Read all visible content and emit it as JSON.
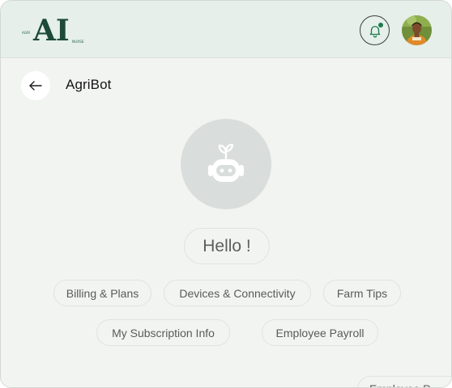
{
  "header": {
    "logo": {
      "small_prefix": "AGRI",
      "big": "AI",
      "small_suffix": "NURSE"
    },
    "bell_icon": "bell-icon",
    "avatar_icon": "user-avatar"
  },
  "page": {
    "back_icon": "arrow-left-icon",
    "title": "AgriBot"
  },
  "chat": {
    "bot_icon": "robot-sprout-icon",
    "greeting": "Hello !",
    "suggestions": [
      "Billing & Plans",
      "Devices & Connectivity",
      "Farm Tips",
      "My Subscription Info",
      "Employee Payroll"
    ],
    "partial_suggestion": "Employee P"
  },
  "colors": {
    "accent": "#1f7a4f",
    "header_bg": "#e6efea",
    "page_bg": "#f2f4f2"
  }
}
